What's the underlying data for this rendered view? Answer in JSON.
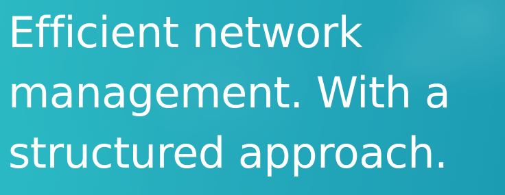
{
  "hero": {
    "headline_lines": [
      "Efficient network",
      "management. With a",
      "structured approach."
    ],
    "background_colors": [
      "#2bb9c3",
      "#22a5b9",
      "#1c9cb3"
    ],
    "text_color": "#ffffff"
  }
}
